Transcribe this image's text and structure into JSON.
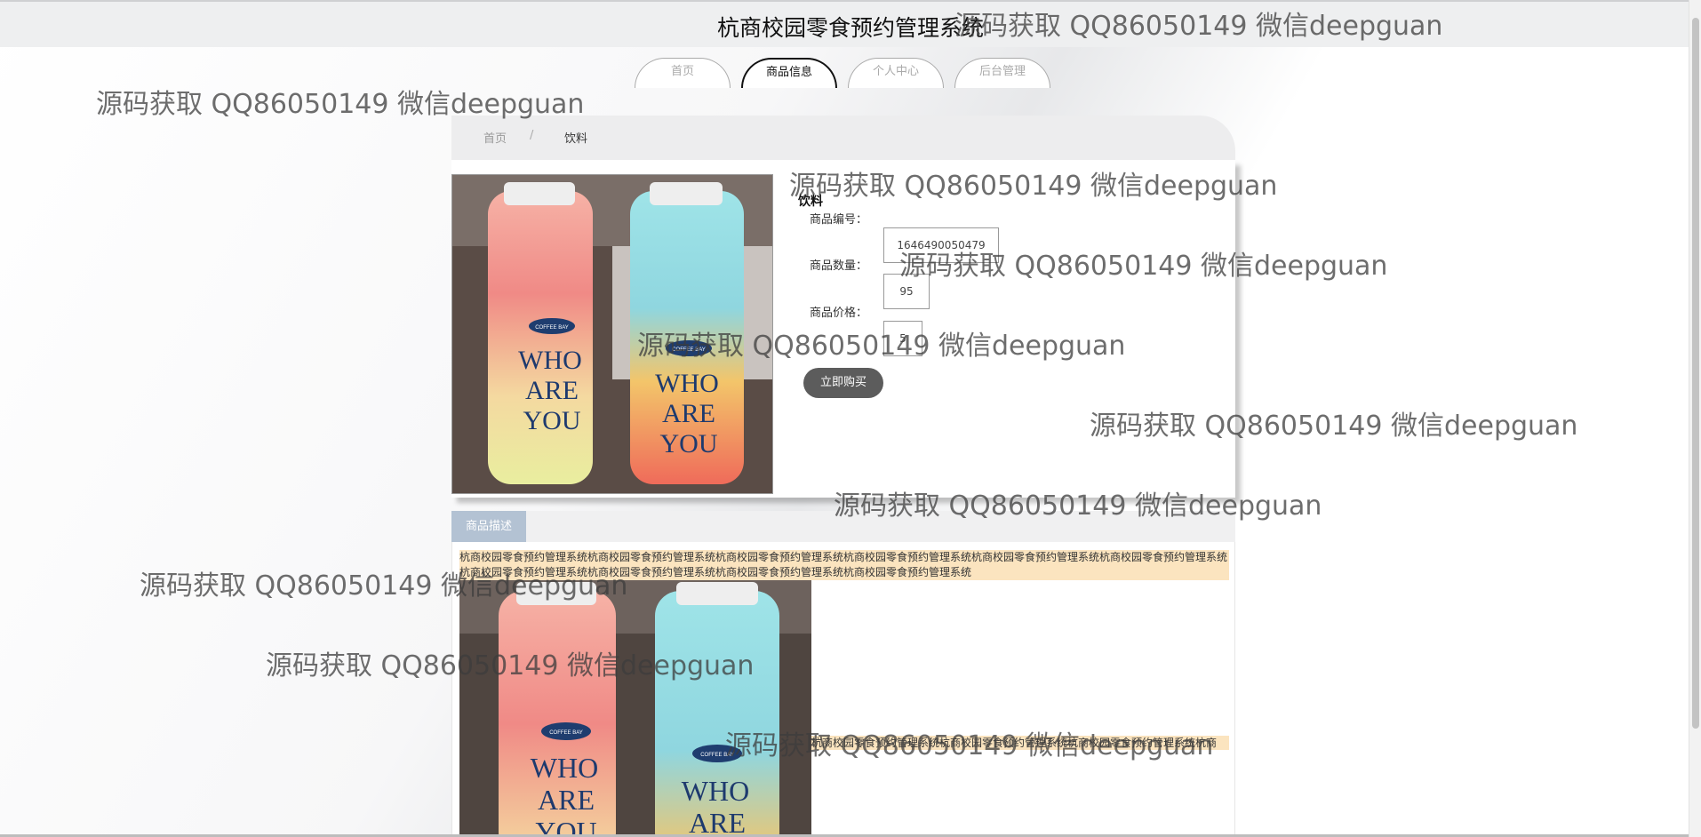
{
  "header": {
    "title": "杭商校园零食预约管理系统"
  },
  "nav": {
    "tabs": [
      {
        "label": "首页",
        "active": false
      },
      {
        "label": "商品信息",
        "active": true
      },
      {
        "label": "个人中心",
        "active": false
      },
      {
        "label": "后台管理",
        "active": false
      }
    ]
  },
  "breadcrumb": {
    "home": "首页",
    "separator": "/",
    "current": "饮料"
  },
  "product": {
    "name": "饮料",
    "fields": {
      "code_label": "商品编号：",
      "code_value": "1646490050479",
      "quantity_label": "商品数量：",
      "quantity_value": "95",
      "price_label": "商品价格：",
      "price_value": "5"
    },
    "buy_label": "立即购买",
    "image_icon": "two-drink-bottles-photo"
  },
  "description": {
    "tab_label": "商品描述",
    "text": "杭商校园零食预约管理系统杭商校园零食预约管理系统杭商校园零食预约管理系统杭商校园零食预约管理系统杭商校园零食预约管理系统杭商校园零食预约管理系统杭商校园零食预约管理系统杭商校园零食预约管理系统杭商校园零食预约管理系统杭商校园零食预约管理系统",
    "caption": "杭商校园零食预约管理系统杭商校园零食预约管理系统杭商校园零食预约管理系统杭商"
  },
  "bottle_text": {
    "badge": "COFFEE BAY",
    "line1": "WHO",
    "line2": "ARE",
    "line3": "YOU"
  },
  "watermark_text": "源码获取 QQ86050149 微信deepguan",
  "colors": {
    "active_tab": "#111111",
    "inactive_tab": "#aaaaaa",
    "buy_button": "#5c5c5c",
    "desc_tab": "#b3c2d3",
    "highlight": "#fbe4bf"
  }
}
